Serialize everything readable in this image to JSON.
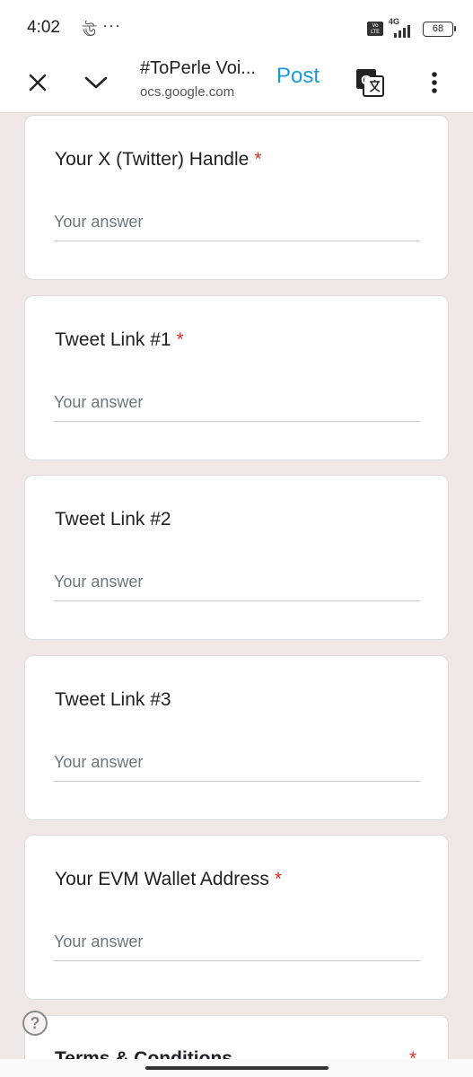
{
  "status_bar": {
    "time": "4:02",
    "notification_glyph": "ঊ",
    "more_dots": "···",
    "volte": "Vo LTE",
    "network": "4G",
    "battery": "68"
  },
  "browser": {
    "title": "#ToPerle Voi...",
    "url": "ocs.google.com",
    "post_label": "Post",
    "icons": {
      "close": "close-icon",
      "collapse": "chevron-down-icon",
      "translate": "translate-icon",
      "menu": "more-vert-icon"
    }
  },
  "form": {
    "placeholder": "Your answer",
    "required_marker": "*",
    "questions": [
      {
        "label": "Your X (Twitter) Handle",
        "required": true
      },
      {
        "label": "Tweet Link #1",
        "required": true
      },
      {
        "label": "Tweet Link #2",
        "required": false
      },
      {
        "label": "Tweet Link #3",
        "required": false
      },
      {
        "label": "Your EVM Wallet Address",
        "required": true
      },
      {
        "label": "Terms & Conditions",
        "required": true
      }
    ]
  },
  "help": {
    "glyph": "?"
  },
  "colors": {
    "page_bg": "#f0e8e6",
    "accent_blue": "#1a9bd7",
    "required_red": "#d93025"
  }
}
